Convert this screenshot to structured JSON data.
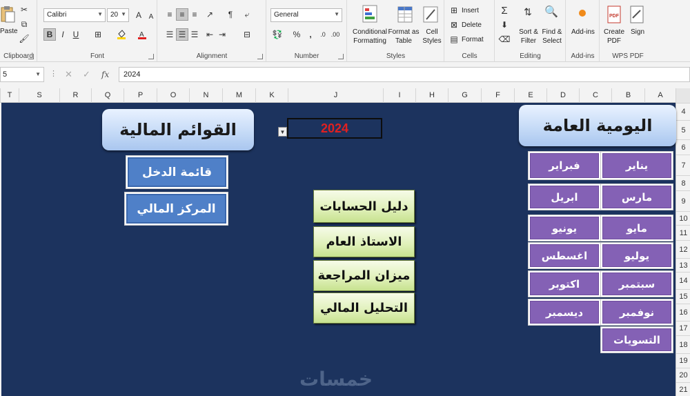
{
  "ribbon": {
    "clipboard": {
      "paste_label": "Paste",
      "group_label": "Clipboard"
    },
    "font": {
      "font_name": "Calibri",
      "font_size": "20",
      "bold": "B",
      "italic": "I",
      "underline": "U",
      "grow": "A",
      "shrink": "A",
      "group_label": "Font"
    },
    "alignment": {
      "group_label": "Alignment"
    },
    "number": {
      "format": "General",
      "percent": "%",
      "comma": ",",
      "group_label": "Number"
    },
    "styles": {
      "conditional_formatting": "Conditional Formatting",
      "format_as_table": "Format as Table",
      "cell_styles": "Cell Styles",
      "group_label": "Styles"
    },
    "cells": {
      "insert": "Insert",
      "delete": "Delete",
      "format": "Format",
      "group_label": "Cells"
    },
    "editing": {
      "sort_filter": "Sort & Filter",
      "find_select": "Find & Select",
      "group_label": "Editing"
    },
    "addins": {
      "label": "Add-ins",
      "group_label": "Add-ins"
    },
    "wps": {
      "create_pdf": "Create PDF",
      "sign": "Sign",
      "group_label": "WPS PDF"
    }
  },
  "formula_bar": {
    "name_box": "5",
    "fx": "fx",
    "value": "2024"
  },
  "columns": [
    "T",
    "S",
    "R",
    "Q",
    "P",
    "O",
    "N",
    "M",
    "K",
    "J",
    "I",
    "H",
    "G",
    "F",
    "E",
    "D",
    "C",
    "B",
    "A"
  ],
  "rows": [
    "4",
    "5",
    "6",
    "7",
    "8",
    "9",
    "10",
    "11",
    "12",
    "13",
    "14",
    "15",
    "16",
    "17",
    "18",
    "19",
    "20",
    "21"
  ],
  "sheet": {
    "financial_statements_title": "القوائم المالية",
    "general_journal_title": "اليومية العامة",
    "year": "2024",
    "income_statement": "قائمة الدخل",
    "financial_position": "المركز المالي",
    "chart_of_accounts": "دليل الحسابات",
    "general_ledger": "الاستاذ العام",
    "trial_balance": "ميزان المراجعة",
    "financial_analysis": "التحليل المالي",
    "months": {
      "jan": "يناير",
      "feb": "فبراير",
      "mar": "مارس",
      "apr": "ابريل",
      "may": "مايو",
      "jun": "يونيو",
      "jul": "يوليو",
      "aug": "اغسطس",
      "sep": "سبتمبر",
      "oct": "اكتوبر",
      "nov": "نوفمبر",
      "dec": "ديسمبر"
    },
    "adjustments": "التسويات",
    "watermark": "خمسات"
  }
}
